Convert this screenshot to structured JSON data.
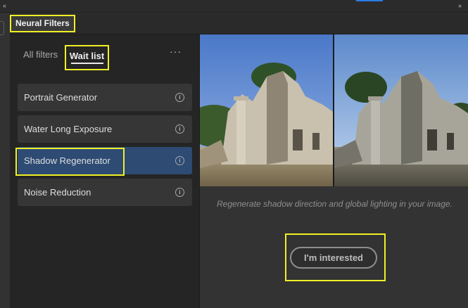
{
  "tab": {
    "title": "Neural Filters"
  },
  "filter_tabs": {
    "all": "All filters",
    "wait": "Wait list",
    "more": "···"
  },
  "filters": [
    {
      "label": "Portrait Generator",
      "info": "i",
      "selected": false
    },
    {
      "label": "Water Long Exposure",
      "info": "i",
      "selected": false
    },
    {
      "label": "Shadow Regenerator",
      "info": "i",
      "selected": true
    },
    {
      "label": "Noise Reduction",
      "info": "i",
      "selected": false
    }
  ],
  "preview": {
    "description": "Regenerate shadow direction and global lighting in your image.",
    "cta_label": "I'm interested"
  },
  "topbar": {
    "left_chevron": "‹‹",
    "right_chevron": "››"
  },
  "colors": {
    "highlight": "#f0f025",
    "selected": "#2d4b73",
    "accent": "#2c7be5"
  }
}
